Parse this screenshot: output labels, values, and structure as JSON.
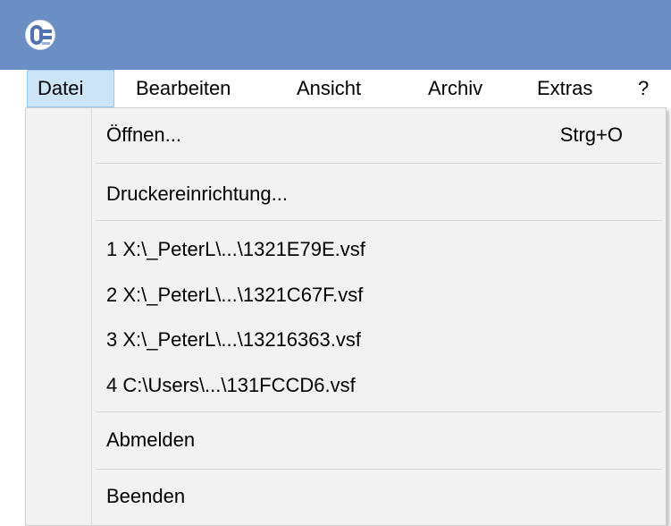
{
  "menubar": {
    "items": [
      {
        "label": "Datei"
      },
      {
        "label": "Bearbeiten"
      },
      {
        "label": "Ansicht"
      },
      {
        "label": "Archiv"
      },
      {
        "label": "Extras"
      },
      {
        "label": "?"
      }
    ]
  },
  "file_menu": {
    "open": {
      "label": "Öffnen...",
      "shortcut": "Strg+O"
    },
    "printer_setup": {
      "label": "Druckereinrichtung..."
    },
    "recent_files": [
      {
        "label": "1 X:\\_PeterL\\...\\1321E79E.vsf"
      },
      {
        "label": "2 X:\\_PeterL\\...\\1321C67F.vsf"
      },
      {
        "label": "3 X:\\_PeterL\\...\\13216363.vsf"
      },
      {
        "label": "4 C:\\Users\\...\\131FCCD6.vsf"
      }
    ],
    "logout": {
      "label": "Abmelden"
    },
    "exit": {
      "label": "Beenden"
    }
  },
  "colors": {
    "titlebar": "#6b8fc4",
    "menu_highlight": "#cce4f7",
    "dropdown_bg": "#f2f2f2"
  },
  "icons": {
    "app": "app-logo-icon"
  }
}
